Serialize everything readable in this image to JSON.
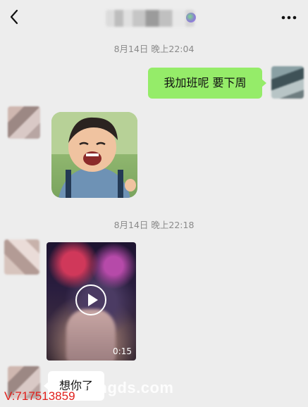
{
  "header": {
    "back_icon": "chevron-left-icon",
    "more_icon": "more-dots-icon"
  },
  "messages": {
    "time1": "8月14日 晚上22:04",
    "text1": "我加班呢  要下周",
    "time2": "8月14日 晚上22:18",
    "video_duration": "0:15",
    "text2": "想你了"
  },
  "watermark": {
    "domain": "fangds.com",
    "id": "V:717513859"
  },
  "colors": {
    "sent_bubble": "#95ec69",
    "background": "#ededed",
    "watermark_red": "#e0201c"
  }
}
